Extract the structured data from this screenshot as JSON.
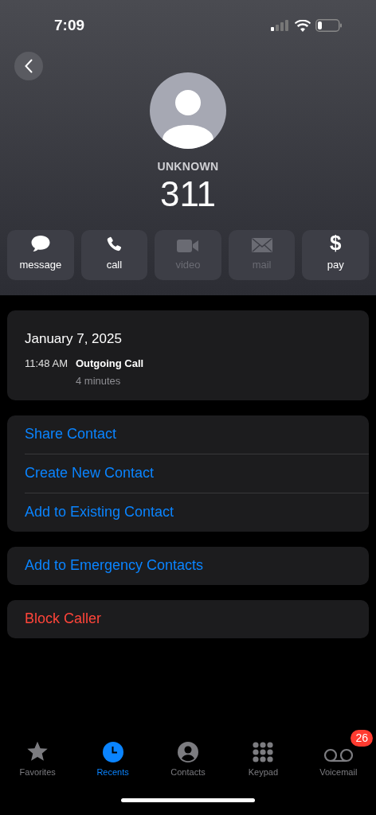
{
  "status_bar": {
    "time": "7:09"
  },
  "contact": {
    "label": "UNKNOWN",
    "number": "311"
  },
  "actions": [
    {
      "label": "message",
      "disabled": false
    },
    {
      "label": "call",
      "disabled": false
    },
    {
      "label": "video",
      "disabled": true
    },
    {
      "label": "mail",
      "disabled": true
    },
    {
      "label": "pay",
      "disabled": false,
      "symbol": "$"
    }
  ],
  "call_log": {
    "date": "January 7, 2025",
    "entries": [
      {
        "time": "11:48 AM",
        "type": "Outgoing Call",
        "duration": "4 minutes"
      }
    ]
  },
  "option_groups": [
    [
      {
        "label": "Share Contact",
        "kind": "normal"
      },
      {
        "label": "Create New Contact",
        "kind": "normal"
      },
      {
        "label": "Add to Existing Contact",
        "kind": "normal"
      }
    ],
    [
      {
        "label": "Add to Emergency Contacts",
        "kind": "normal"
      }
    ],
    [
      {
        "label": "Block Caller",
        "kind": "destructive"
      }
    ]
  ],
  "tab_bar": [
    {
      "label": "Favorites",
      "selected": false
    },
    {
      "label": "Recents",
      "selected": true
    },
    {
      "label": "Contacts",
      "selected": false
    },
    {
      "label": "Keypad",
      "selected": false
    },
    {
      "label": "Voicemail",
      "selected": false,
      "badge": "26"
    }
  ]
}
